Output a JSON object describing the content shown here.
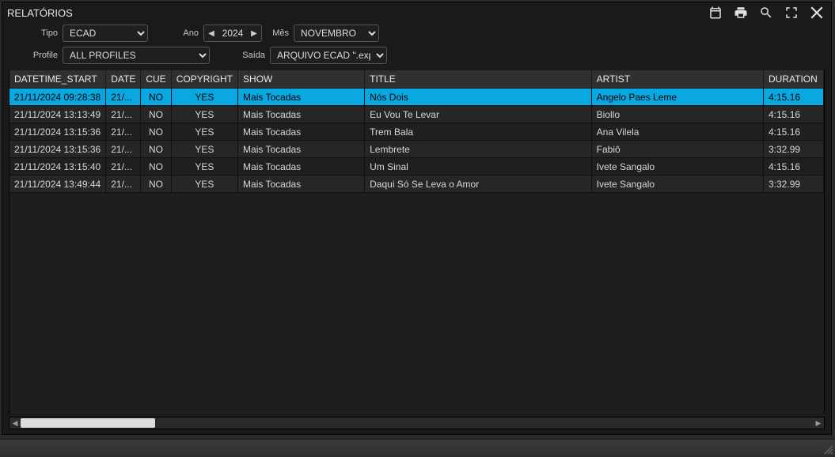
{
  "title": "RELATÓRIOS",
  "filters": {
    "tipo_label": "Tipo",
    "tipo_value": "ECAD",
    "ano_label": "Ano",
    "ano_value": "2024",
    "mes_label": "Mês",
    "mes_value": "NOVEMBRO",
    "profile_label": "Profile",
    "profile_value": "ALL PROFILES",
    "saida_label": "Saída",
    "saida_value": "ARQUIVO  ECAD \".exp\""
  },
  "columns": {
    "dt": "DATETIME_START",
    "date": "DATE",
    "cue": "CUE",
    "copy": "COPYRIGHT",
    "show": "SHOW",
    "title": "TITLE",
    "artist": "ARTIST",
    "dur": "DURATION"
  },
  "rows": [
    {
      "dt": "21/11/2024 09:28:38",
      "date": "21/...",
      "cue": "NO",
      "copy": "YES",
      "show": "Mais Tocadas",
      "title": "Nós Dois",
      "artist": "Angelo Paes Leme",
      "dur": "4:15.16",
      "selected": true
    },
    {
      "dt": "21/11/2024 13:13:49",
      "date": "21/...",
      "cue": "NO",
      "copy": "YES",
      "show": "Mais Tocadas",
      "title": "Eu Vou Te Levar",
      "artist": "Biollo",
      "dur": "4:15.16"
    },
    {
      "dt": "21/11/2024 13:15:36",
      "date": "21/...",
      "cue": "NO",
      "copy": "YES",
      "show": "Mais Tocadas",
      "title": "Trem Bala",
      "artist": "Ana Vilela",
      "dur": "4:15.16"
    },
    {
      "dt": "21/11/2024 13:15:36",
      "date": "21/...",
      "cue": "NO",
      "copy": "YES",
      "show": "Mais Tocadas",
      "title": "Lembrete",
      "artist": "Fabiô",
      "dur": "3:32.99"
    },
    {
      "dt": "21/11/2024 13:15:40",
      "date": "21/...",
      "cue": "NO",
      "copy": "YES",
      "show": "Mais Tocadas",
      "title": "Um Sinal",
      "artist": "Ivete Sangalo",
      "dur": "4:15.16"
    },
    {
      "dt": "21/11/2024 13:49:44",
      "date": "21/...",
      "cue": "NO",
      "copy": "YES",
      "show": "Mais Tocadas",
      "title": "Daqui Só Se Leva o Amor",
      "artist": "Ivete Sangalo",
      "dur": "3:32.99"
    }
  ]
}
